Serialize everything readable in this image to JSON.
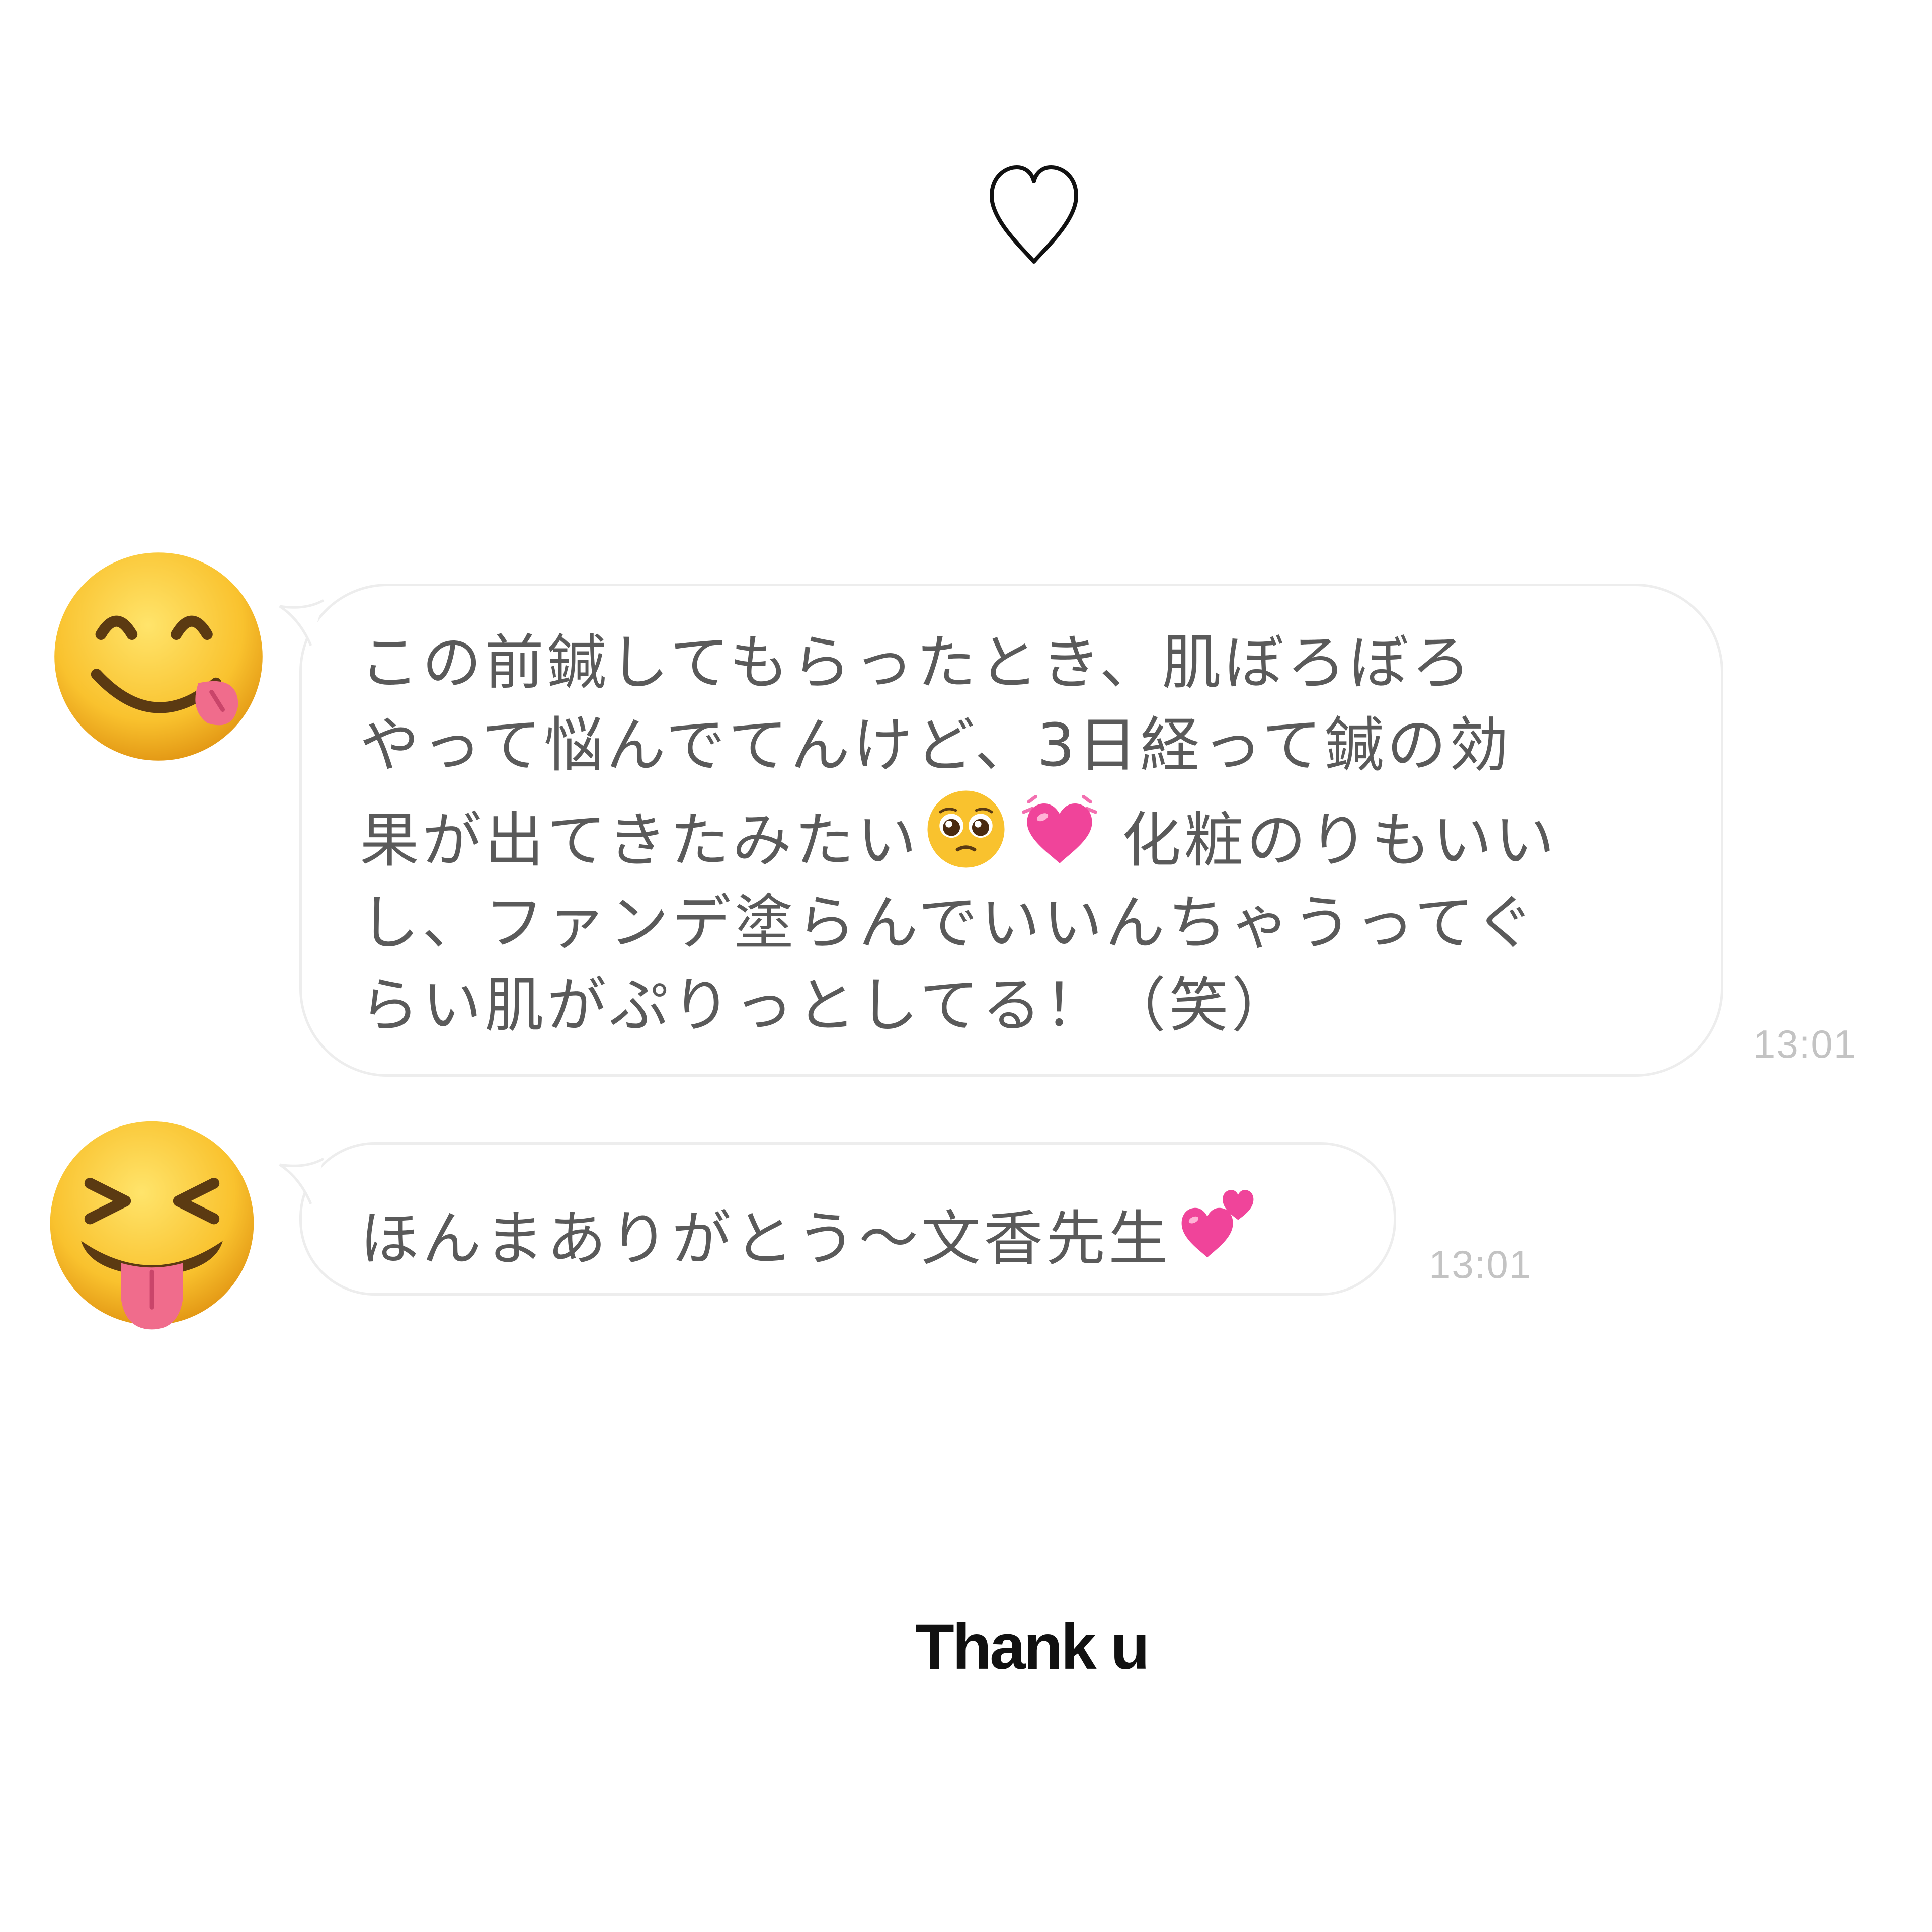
{
  "story": {
    "top_icon": "heart-outline-icon",
    "caption": "Thank u"
  },
  "chat": {
    "messages": [
      {
        "avatar": "face-savoring-food-emoji",
        "lines": [
          "この前鍼してもらったとき、肌ぼろぼろ",
          "やって悩んでてんけど、3日経って鍼の効",
          "果が出てきたみたい",
          "化粧のりもいい",
          "し、ファンデ塗らんでいいんちゃうってぐ",
          "らい肌がぷりっとしてる！（笑）"
        ],
        "inline_emojis": [
          "pleading-face-emoji",
          "growing-heart-emoji"
        ],
        "time": "13:01"
      },
      {
        "avatar": "squinting-face-with-tongue-emoji",
        "text": "ほんまありがとう〜文香先生",
        "inline_emojis": [
          "two-hearts-emoji"
        ],
        "time": "13:01"
      }
    ]
  },
  "colors": {
    "background": "#ffffff",
    "bubble_border": "#ededed",
    "message_text": "#5a5a5a",
    "timestamp": "#c3c3c3",
    "heart_pink": "#f0449a",
    "emoji_yellow": "#f7c02c"
  }
}
